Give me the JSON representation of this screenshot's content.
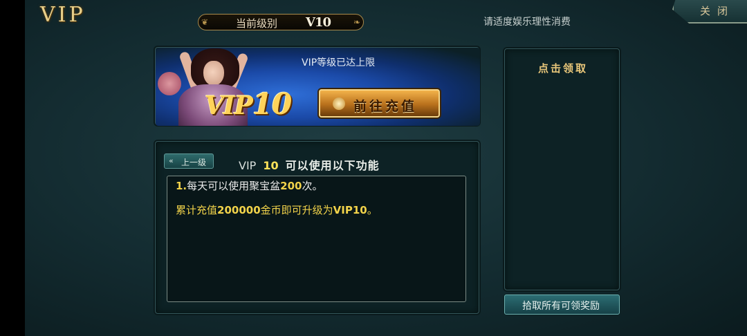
{
  "header": {
    "title": "VIP",
    "level_label": "当前级别",
    "level_badge": "V10",
    "notice": "请适度娱乐理性消费",
    "close_label": "关闭"
  },
  "banner": {
    "max_notice": "VIP等级已达上限",
    "vip_prefix": "VIP",
    "vip_number": "10",
    "recharge_label": "前往充值"
  },
  "features": {
    "prev_label": "上一级",
    "head_prefix": "VIP",
    "head_level": "10",
    "head_desc": "可以使用以下功能",
    "line_no": "1.",
    "line_text_a": "每天可以使用聚宝盆",
    "line_value": "200",
    "line_text_b": "次。",
    "upgrade_a": "累计充值",
    "upgrade_value": "200000",
    "upgrade_b": "金币即可升级为",
    "upgrade_target": "VIP10",
    "upgrade_end": "。"
  },
  "rewards": {
    "title": "点击领取",
    "claim_all_label": "拾取所有可领奖励"
  },
  "colors": {
    "gold": "#ffd35a",
    "teal_panel": "#0d2225",
    "accent_yellow": "#f2d34a"
  }
}
